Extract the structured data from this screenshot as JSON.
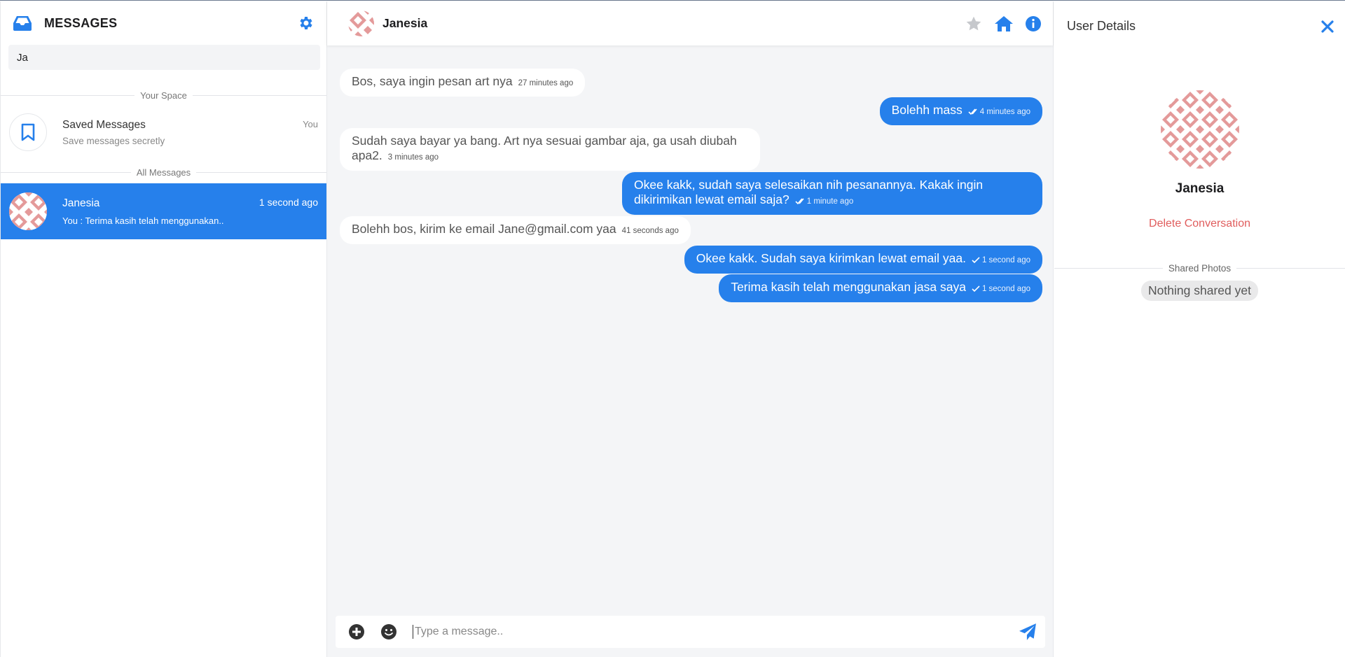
{
  "colors": {
    "accent": "#2680eb",
    "danger": "#e05d5d",
    "chat_bg": "#f4f5f7",
    "avatar_pattern": "#e49a9a"
  },
  "sidebar": {
    "title": "MESSAGES",
    "search_value": "Ja",
    "your_space_label": "Your Space",
    "saved": {
      "title": "Saved Messages",
      "subtitle": "Save messages secretly",
      "meta": "You"
    },
    "all_messages_label": "All Messages",
    "contacts": [
      {
        "name": "Janesia",
        "preview": "You : Terima kasih telah menggunakan..",
        "time": "1 second ago",
        "selected": true
      }
    ]
  },
  "chat": {
    "contact_name": "Janesia",
    "icons": [
      "star-icon",
      "home-icon",
      "info-icon"
    ],
    "messages": [
      {
        "direction": "in",
        "text": "Bos, saya ingin pesan art nya",
        "time": "27 minutes ago"
      },
      {
        "direction": "out",
        "text": "Bolehh mass",
        "time": "4 minutes ago",
        "status": "read"
      },
      {
        "direction": "in",
        "text": "Sudah saya bayar ya bang. Art nya sesuai gambar aja, ga usah diubah apa2.",
        "time": "3 minutes ago"
      },
      {
        "direction": "out",
        "text": "Okee kakk, sudah saya selesaikan nih pesanannya. Kakak ingin dikirimikan lewat email saja?",
        "time": "1 minute ago",
        "status": "read"
      },
      {
        "direction": "in",
        "text": "Bolehh bos, kirim ke email Jane@gmail.com yaa",
        "time": "41 seconds ago"
      },
      {
        "direction": "out",
        "text": "Okee kakk. Sudah saya kirimkan lewat email yaa.",
        "time": "1 second ago",
        "status": "sent"
      },
      {
        "direction": "out",
        "text": "Terima kasih telah menggunakan jasa saya",
        "time": "1 second ago",
        "status": "sent"
      }
    ],
    "composer": {
      "placeholder": "Type a message.."
    }
  },
  "details": {
    "title": "User Details",
    "name": "Janesia",
    "delete_label": "Delete Conversation",
    "shared_photos_label": "Shared Photos",
    "empty_label": "Nothing shared yet"
  }
}
